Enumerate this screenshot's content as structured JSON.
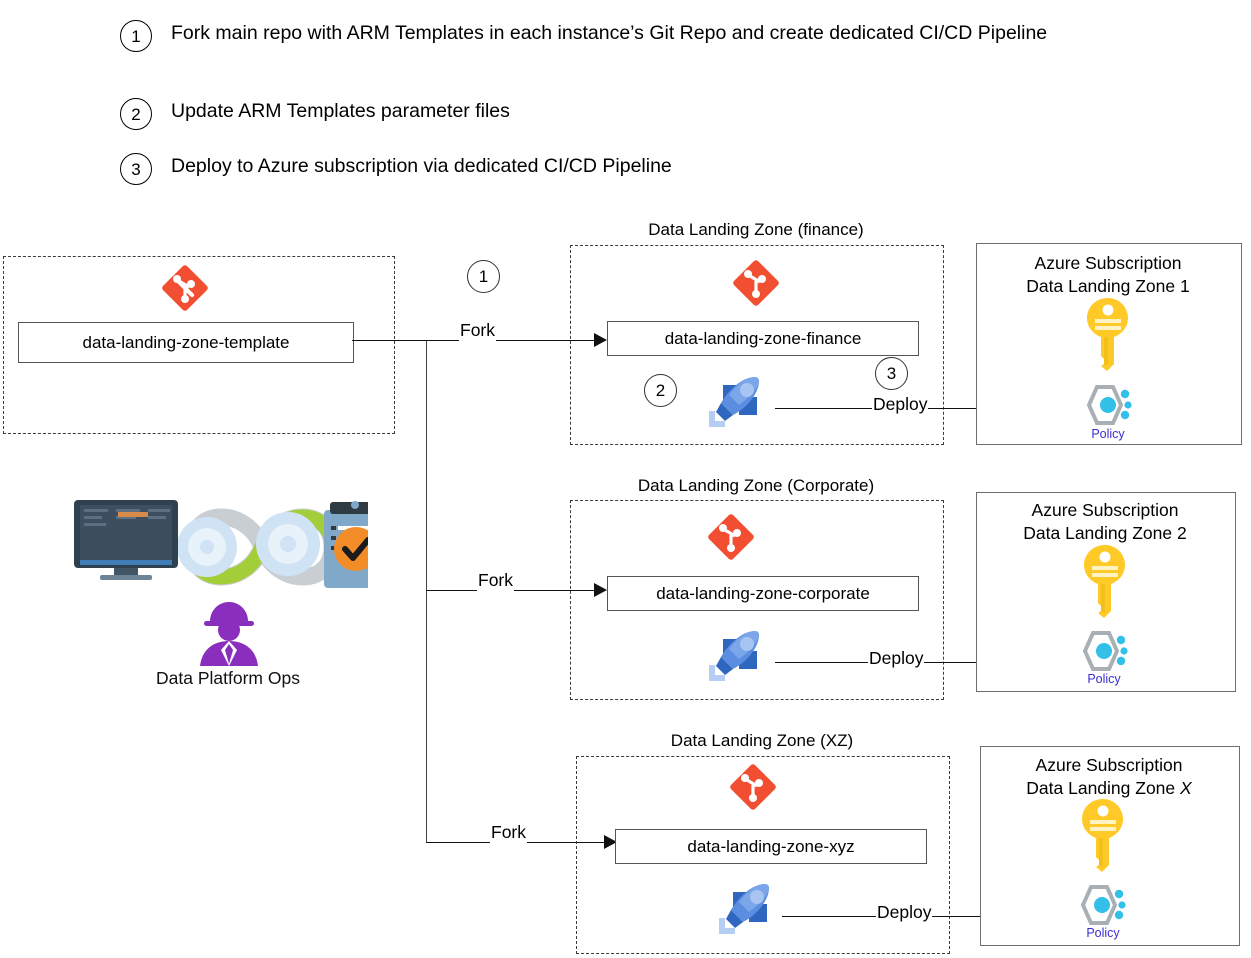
{
  "legend": {
    "items": [
      {
        "num": "1",
        "text": "Fork main repo with ARM Templates in each instance’s Git Repo and create dedicated CI/CD Pipeline"
      },
      {
        "num": "2",
        "text": "Update ARM Templates parameter files"
      },
      {
        "num": "3",
        "text": "Deploy to Azure subscription via dedicated CI/CD Pipeline"
      }
    ]
  },
  "source": {
    "repo_label": "data-landing-zone-template",
    "git_icon": "git-icon"
  },
  "persona": {
    "label": "Data Platform Ops",
    "icon": "devops-infinity-icon"
  },
  "connectors": {
    "fork_label": "Fork",
    "deploy_label": "Deploy",
    "step1": "1",
    "step2": "2",
    "step3": "3"
  },
  "zones": [
    {
      "title": "Data Landing Zone (finance)",
      "repo_label": "data-landing-zone-finance",
      "git_icon": "git-icon",
      "pipeline_icon": "azure-pipelines-rocket-icon",
      "show_steps": true
    },
    {
      "title": "Data Landing Zone (Corporate)",
      "repo_label": "data-landing-zone-corporate",
      "git_icon": "git-icon",
      "pipeline_icon": "azure-pipelines-rocket-icon",
      "show_steps": false
    },
    {
      "title": "Data Landing Zone (XZ)",
      "repo_label": "data-landing-zone-xyz",
      "git_icon": "git-icon",
      "pipeline_icon": "azure-pipelines-rocket-icon",
      "show_steps": false
    }
  ],
  "subscriptions": [
    {
      "line1": "Azure Subscription",
      "line2": "Data Landing Zone 1",
      "policy_label": "Policy",
      "key_icon": "key-icon",
      "policy_icon": "azure-policy-icon"
    },
    {
      "line1": "Azure Subscription",
      "line2": "Data Landing Zone 2",
      "policy_label": "Policy",
      "key_icon": "key-icon",
      "policy_icon": "azure-policy-icon"
    },
    {
      "line1": "Azure Subscription",
      "line2": "Data Landing Zone ",
      "line2_italic": "X",
      "policy_label": "Policy",
      "key_icon": "key-icon",
      "policy_icon": "azure-policy-icon"
    }
  ],
  "colors": {
    "git_orange": "#f14e32",
    "pipeline_blue": "#5b8ee0",
    "pipeline_dark": "#2f66bf",
    "key_yellow": "#ffca28",
    "policy_blue": "#32bfe8",
    "policy_gray": "#a9b0b5",
    "persona_purple": "#8a2fbd",
    "persona_green": "#a4ce39",
    "persona_orange": "#f28c28"
  }
}
